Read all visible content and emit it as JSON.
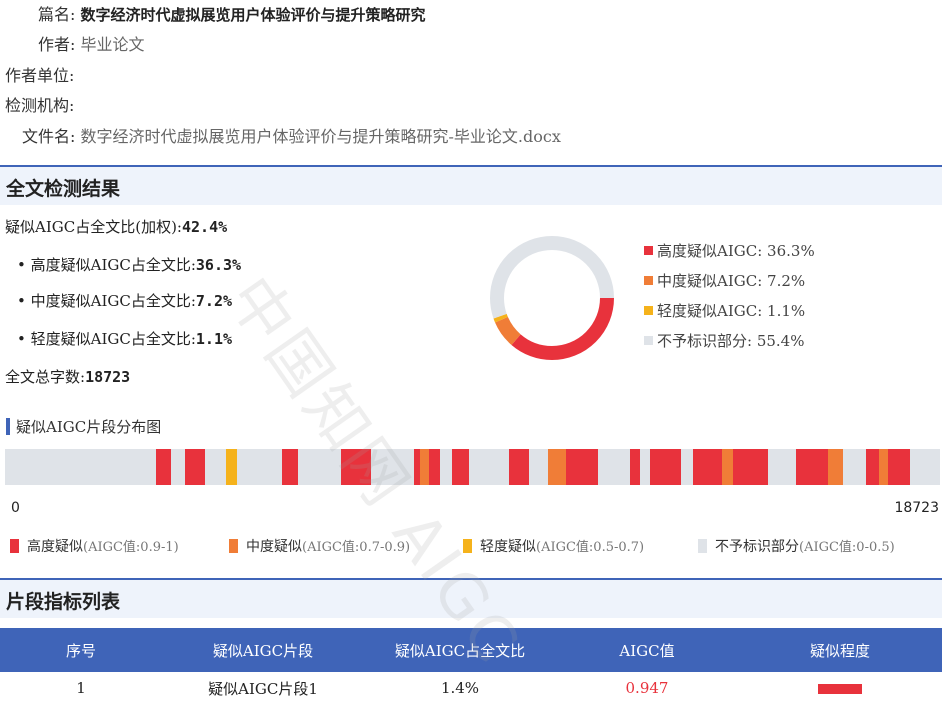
{
  "meta": {
    "title_label": "篇名:",
    "title_value": "数字经济时代虚拟展览用户体验评价与提升策略研究",
    "author_label": "作者:",
    "author_value": "毕业论文",
    "unit_label": "作者单位:",
    "org_label": "检测机构:",
    "file_label": "文件名:",
    "file_value": "数字经济时代虚拟展览用户体验评价与提升策略研究-毕业论文.docx"
  },
  "result": {
    "heading": "全文检测结果",
    "weighted_label": "疑似AIGC占全文比(加权):",
    "weighted_value": "42.4%",
    "high_label": "• 高度疑似AIGC占全文比:",
    "high_value": "36.3%",
    "mid_label": "• 中度疑似AIGC占全文比:",
    "mid_value": "7.2%",
    "low_label": "• 轻度疑似AIGC占全文比:",
    "low_value": "1.1%",
    "total_label": "全文总字数:",
    "total_value": "18723"
  },
  "chart_data": [
    {
      "type": "pie",
      "slices": [
        {
          "label": "高度疑似AIGC:",
          "value": 36.3,
          "display": "36.3%",
          "color": "#e8323c"
        },
        {
          "label": "中度疑似AIGC:",
          "value": 7.2,
          "display": "7.2%",
          "color": "#f07d37"
        },
        {
          "label": "轻度疑似AIGC:",
          "value": 1.1,
          "display": "1.1%",
          "color": "#f5b21b"
        },
        {
          "label": "不予标识部分:",
          "value": 55.4,
          "display": "55.4%",
          "color": "#dfe3e8"
        }
      ],
      "legend_position": "right"
    },
    {
      "type": "bar",
      "title": "疑似AIGC片段分布图",
      "x_range": [
        0,
        18723
      ],
      "x_min_label": "0",
      "x_max_label": "18723",
      "segments": [
        {
          "start": 3020,
          "end": 3330,
          "level": "high"
        },
        {
          "start": 3610,
          "end": 4000,
          "level": "high"
        },
        {
          "start": 4430,
          "end": 4650,
          "level": "low"
        },
        {
          "start": 5540,
          "end": 5860,
          "level": "high"
        },
        {
          "start": 6720,
          "end": 7330,
          "level": "high"
        },
        {
          "start": 8190,
          "end": 8320,
          "level": "high"
        },
        {
          "start": 8320,
          "end": 8500,
          "level": "mid"
        },
        {
          "start": 8500,
          "end": 8710,
          "level": "high"
        },
        {
          "start": 8950,
          "end": 9300,
          "level": "high"
        },
        {
          "start": 10100,
          "end": 10500,
          "level": "high"
        },
        {
          "start": 10880,
          "end": 11230,
          "level": "mid"
        },
        {
          "start": 11230,
          "end": 11880,
          "level": "high"
        },
        {
          "start": 12510,
          "end": 12720,
          "level": "high"
        },
        {
          "start": 12920,
          "end": 13530,
          "level": "high"
        },
        {
          "start": 13770,
          "end": 14360,
          "level": "high"
        },
        {
          "start": 14360,
          "end": 14580,
          "level": "mid"
        },
        {
          "start": 14580,
          "end": 15280,
          "level": "high"
        },
        {
          "start": 15840,
          "end": 16480,
          "level": "high"
        },
        {
          "start": 16480,
          "end": 16790,
          "level": "mid"
        },
        {
          "start": 17250,
          "end": 17510,
          "level": "high"
        },
        {
          "start": 17510,
          "end": 17690,
          "level": "mid"
        },
        {
          "start": 17690,
          "end": 18130,
          "level": "high"
        }
      ],
      "legend": [
        {
          "level": "high",
          "label": "高度疑似",
          "range": "(AIGC值:0.9-1)",
          "color": "#e8323c"
        },
        {
          "level": "mid",
          "label": "中度疑似",
          "range": "(AIGC值:0.7-0.9)",
          "color": "#f07d37"
        },
        {
          "level": "low",
          "label": "轻度疑似",
          "range": "(AIGC值:0.5-0.7)",
          "color": "#f5b21b"
        },
        {
          "level": "none",
          "label": "不予标识部分",
          "range": "(AIGC值:0-0.5)",
          "color": "#dfe3e8"
        }
      ]
    }
  ],
  "table": {
    "heading": "片段指标列表",
    "columns": [
      "序号",
      "疑似AIGC片段",
      "疑似AIGC占全文比",
      "AIGC值",
      "疑似程度"
    ],
    "rows": [
      {
        "no": "1",
        "segment": "疑似AIGC片段1",
        "ratio": "1.4%",
        "value": "0.947",
        "degree_color": "#e8323c"
      }
    ],
    "value_color": "#e8323c"
  },
  "watermark": "中国知网 AIGC"
}
